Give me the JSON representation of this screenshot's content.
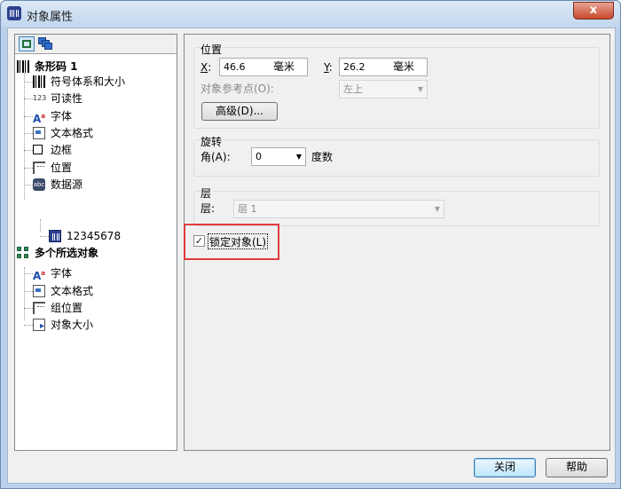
{
  "window": {
    "title": "对象属性",
    "close_glyph": "x"
  },
  "tree": {
    "items": [
      {
        "label": "条形码 1",
        "icon": "barcode-icon"
      },
      {
        "label": "符号体系和大小",
        "icon": "barcode-lines-icon"
      },
      {
        "label": "可读性",
        "icon": "digits-123-icon",
        "icon_text": "123"
      },
      {
        "label": "字体",
        "icon": "font-icon",
        "icon_text": "A"
      },
      {
        "label": "文本格式",
        "icon": "text-format-icon"
      },
      {
        "label": "边框",
        "icon": "border-icon"
      },
      {
        "label": "位置",
        "icon": "position-icon"
      },
      {
        "label": "数据源",
        "icon": "datasource-icon",
        "icon_text": "abc"
      },
      {
        "label": "12345678",
        "icon": "barcode-file-icon"
      },
      {
        "label": "多个所选对象",
        "icon": "multi-select-icon"
      },
      {
        "label": "字体",
        "icon": "font-icon",
        "icon_text": "A"
      },
      {
        "label": "文本格式",
        "icon": "text-format-icon"
      },
      {
        "label": "组位置",
        "icon": "group-position-icon"
      },
      {
        "label": "对象大小",
        "icon": "object-size-icon"
      }
    ]
  },
  "position_group": {
    "title": "位置",
    "x_label": "X",
    "x_value": "46.6",
    "y_label": "Y",
    "y_value": "26.2",
    "unit": "毫米",
    "ref_label": "对象参考点(O):",
    "ref_value": "左上",
    "advanced_button": "高级(D)..."
  },
  "rotation_group": {
    "title": "旋转",
    "angle_label": "角(A):",
    "angle_value": "0",
    "unit": "度数"
  },
  "layer_group": {
    "title": "层",
    "layer_label": "层:",
    "layer_value": "层 1"
  },
  "lock": {
    "label": "锁定对象(L)",
    "checked": true,
    "check_glyph": "✓"
  },
  "footer": {
    "close_button": "关闭",
    "help_button": "帮助"
  }
}
